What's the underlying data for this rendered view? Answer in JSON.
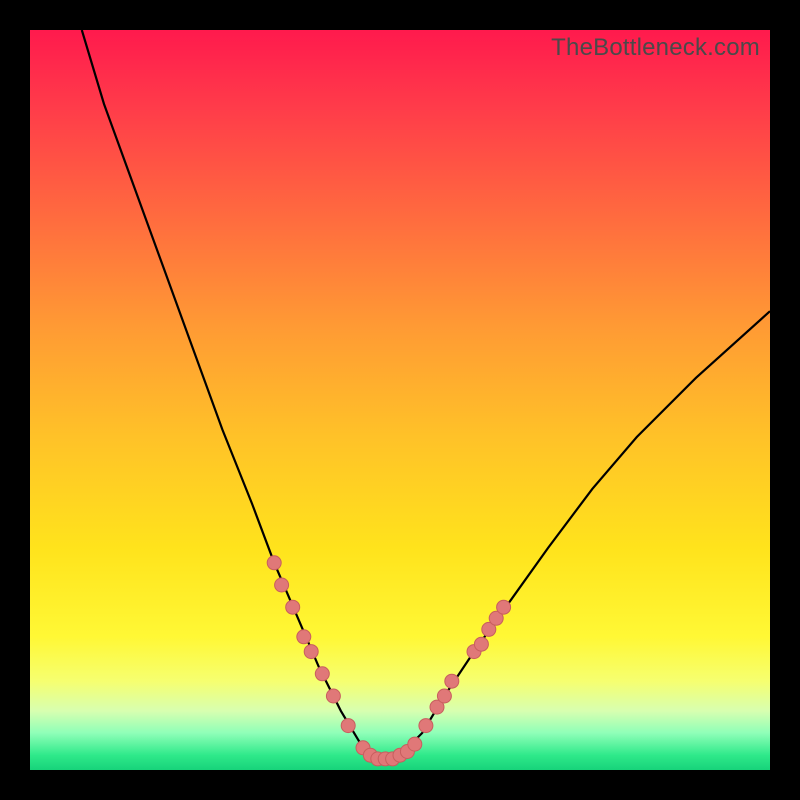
{
  "watermark": "TheBottleneck.com",
  "colors": {
    "frame": "#000000",
    "curve": "#000000",
    "marker_fill": "#e07878",
    "marker_stroke": "#c85e5e",
    "gradient_top": "#ff1a4d",
    "gradient_bottom": "#17d37a"
  },
  "chart_data": {
    "type": "line",
    "title": "",
    "xlabel": "",
    "ylabel": "",
    "xlim": [
      0,
      100
    ],
    "ylim": [
      0,
      100
    ],
    "grid": false,
    "note": "Axes are implicit (no tick labels rendered). x maps left→right 0–100; y maps bottom→top 0–100. Curve y≈|x−47|-shaped bottleneck curve; values estimated from pixel positions.",
    "series": [
      {
        "name": "bottleneck-curve",
        "x": [
          7,
          10,
          14,
          18,
          22,
          26,
          30,
          33,
          36,
          39,
          42,
          45,
          47,
          50,
          53,
          56,
          60,
          65,
          70,
          76,
          82,
          90,
          100
        ],
        "y": [
          100,
          90,
          79,
          68,
          57,
          46,
          36,
          28,
          21,
          14,
          8,
          3,
          1,
          2,
          5,
          10,
          16,
          23,
          30,
          38,
          45,
          53,
          62
        ]
      }
    ],
    "markers": {
      "name": "highlighted-points",
      "note": "Salmon dots clustered near the trough and along both flanks of the curve.",
      "points": [
        {
          "x": 33,
          "y": 28
        },
        {
          "x": 34,
          "y": 25
        },
        {
          "x": 35.5,
          "y": 22
        },
        {
          "x": 37,
          "y": 18
        },
        {
          "x": 38,
          "y": 16
        },
        {
          "x": 39.5,
          "y": 13
        },
        {
          "x": 41,
          "y": 10
        },
        {
          "x": 43,
          "y": 6
        },
        {
          "x": 45,
          "y": 3
        },
        {
          "x": 46,
          "y": 2
        },
        {
          "x": 47,
          "y": 1.5
        },
        {
          "x": 48,
          "y": 1.5
        },
        {
          "x": 49,
          "y": 1.5
        },
        {
          "x": 50,
          "y": 2
        },
        {
          "x": 51,
          "y": 2.5
        },
        {
          "x": 52,
          "y": 3.5
        },
        {
          "x": 53.5,
          "y": 6
        },
        {
          "x": 55,
          "y": 8.5
        },
        {
          "x": 56,
          "y": 10
        },
        {
          "x": 57,
          "y": 12
        },
        {
          "x": 60,
          "y": 16
        },
        {
          "x": 61,
          "y": 17
        },
        {
          "x": 62,
          "y": 19
        },
        {
          "x": 63,
          "y": 20.5
        },
        {
          "x": 64,
          "y": 22
        }
      ]
    }
  }
}
